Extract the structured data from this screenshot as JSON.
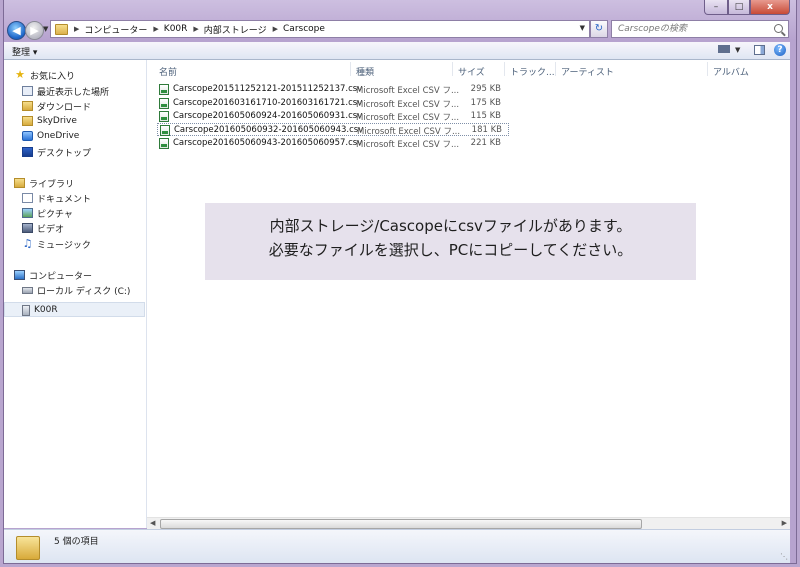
{
  "window": {
    "caption_buttons": {
      "minimize": "–",
      "maximize": "□",
      "close": "x"
    }
  },
  "address": {
    "crumbs": [
      "コンピューター",
      "K00R",
      "内部ストレージ",
      "Carscope"
    ],
    "search_placeholder": "Carscopeの検索"
  },
  "toolbar": {
    "organize_label": "整理 ▾"
  },
  "sidebar": {
    "favorites": {
      "label": "お気に入り",
      "items": [
        {
          "label": "最近表示した場所",
          "icon": "recent-places-icon"
        },
        {
          "label": "ダウンロード",
          "icon": "downloads-folder-icon"
        },
        {
          "label": "SkyDrive",
          "icon": "skydrive-folder-icon"
        },
        {
          "label": "OneDrive",
          "icon": "onedrive-icon"
        },
        {
          "label": "デスクトップ",
          "icon": "desktop-icon"
        }
      ]
    },
    "libraries": {
      "label": "ライブラリ",
      "items": [
        {
          "label": "ドキュメント",
          "icon": "documents-icon"
        },
        {
          "label": "ピクチャ",
          "icon": "pictures-icon"
        },
        {
          "label": "ビデオ",
          "icon": "videos-icon"
        },
        {
          "label": "ミュージック",
          "icon": "music-icon"
        }
      ]
    },
    "computer": {
      "label": "コンピューター",
      "items": [
        {
          "label": "ローカル ディスク (C:)",
          "icon": "local-disk-icon"
        },
        {
          "label": "K00R",
          "icon": "portable-device-icon",
          "selected": true
        }
      ]
    }
  },
  "columns": [
    "名前",
    "種類",
    "サイズ",
    "トラック...",
    "アーティスト",
    "アルバム"
  ],
  "files": [
    {
      "name": "Carscope201511252121-201511252137.csv",
      "type": "Microsoft Excel CSV フ...",
      "size": "295 KB"
    },
    {
      "name": "Carscope201603161710-201603161721.csv",
      "type": "Microsoft Excel CSV フ...",
      "size": "175 KB"
    },
    {
      "name": "Carscope201605060924-201605060931.csv",
      "type": "Microsoft Excel CSV フ...",
      "size": "115 KB"
    },
    {
      "name": "Carscope201605060932-201605060943.csv",
      "type": "Microsoft Excel CSV フ...",
      "size": "181 KB",
      "focused": true
    },
    {
      "name": "Carscope201605060943-201605060957.csv",
      "type": "Microsoft Excel CSV フ...",
      "size": "221 KB"
    }
  ],
  "note": {
    "line1": "内部ストレージ/Cascopeにcsvファイルがあります。",
    "line2": "必要なファイルを選択し、PCにコピーしてください。"
  },
  "status": {
    "item_count": "5 個の項目"
  }
}
